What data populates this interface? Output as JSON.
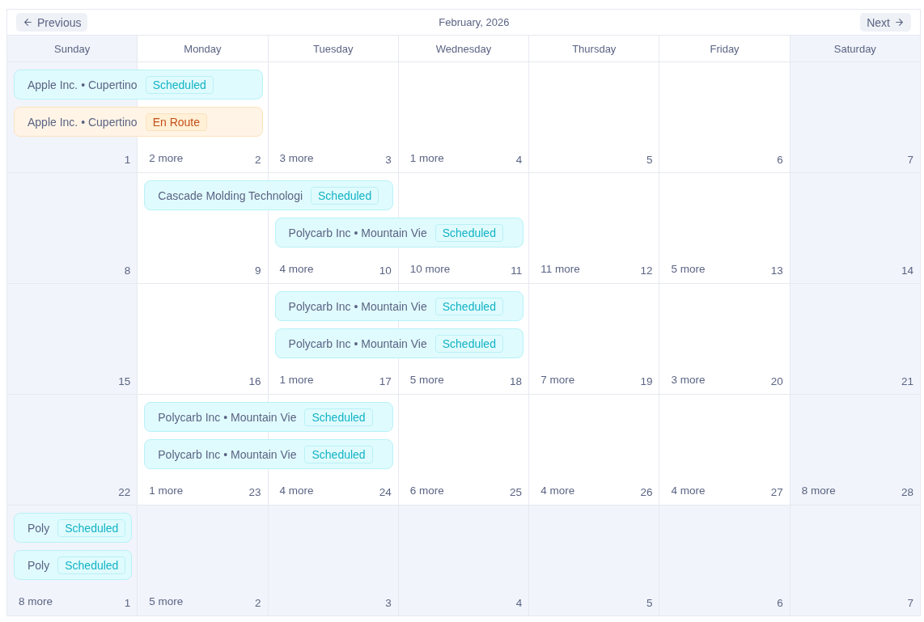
{
  "header": {
    "previous": "Previous",
    "title": "February, 2026",
    "next": "Next"
  },
  "weekdays": [
    {
      "label": "Sunday",
      "muted": true
    },
    {
      "label": "Monday",
      "muted": false
    },
    {
      "label": "Tuesday",
      "muted": false
    },
    {
      "label": "Wednesday",
      "muted": false
    },
    {
      "label": "Thursday",
      "muted": false
    },
    {
      "label": "Friday",
      "muted": false
    },
    {
      "label": "Saturday",
      "muted": true
    }
  ],
  "weeks": [
    {
      "days": [
        {
          "date": "1",
          "muted": true,
          "events": [
            {
              "title": "Apple Inc. • Cupertino",
              "status": "Scheduled",
              "kind": "scheduled",
              "multi_day": true
            },
            {
              "title": "Apple Inc. • Cupertino",
              "status": "En Route",
              "kind": "en_route",
              "multi_day": true
            }
          ]
        },
        {
          "date": "2",
          "more": "2 more",
          "muted": false
        },
        {
          "date": "3",
          "more": "3 more",
          "muted": false
        },
        {
          "date": "4",
          "more": "1 more",
          "muted": false
        },
        {
          "date": "5",
          "muted": false
        },
        {
          "date": "6",
          "muted": false
        },
        {
          "date": "7",
          "muted": true
        }
      ]
    },
    {
      "days": [
        {
          "date": "8",
          "muted": true
        },
        {
          "date": "9",
          "muted": false,
          "events": [
            {
              "title": "Cascade Molding Technologi",
              "status": "Scheduled",
              "kind": "scheduled",
              "multi_day": true
            }
          ]
        },
        {
          "date": "10",
          "more": "4 more",
          "muted": false,
          "events": [
            {
              "title": "Polycarb Inc • Mountain Vie",
              "status": "Scheduled",
              "kind": "scheduled",
              "multi_day": true
            }
          ]
        },
        {
          "date": "11",
          "more": "10 more",
          "muted": false
        },
        {
          "date": "12",
          "more": "11 more",
          "muted": false
        },
        {
          "date": "13",
          "more": "5 more",
          "muted": false
        },
        {
          "date": "14",
          "muted": true
        }
      ]
    },
    {
      "days": [
        {
          "date": "15",
          "muted": true
        },
        {
          "date": "16",
          "muted": false
        },
        {
          "date": "17",
          "more": "1 more",
          "muted": false,
          "events": [
            {
              "title": "Polycarb Inc • Mountain Vie",
              "status": "Scheduled",
              "kind": "scheduled",
              "multi_day": true
            },
            {
              "title": "Polycarb Inc • Mountain Vie",
              "status": "Scheduled",
              "kind": "scheduled",
              "multi_day": true
            }
          ]
        },
        {
          "date": "18",
          "more": "5 more",
          "muted": false
        },
        {
          "date": "19",
          "more": "7 more",
          "muted": false
        },
        {
          "date": "20",
          "more": "3 more",
          "muted": false
        },
        {
          "date": "21",
          "muted": true
        }
      ]
    },
    {
      "days": [
        {
          "date": "22",
          "muted": true
        },
        {
          "date": "23",
          "more": "1 more",
          "muted": false,
          "events": [
            {
              "title": "Polycarb Inc • Mountain Vie",
              "status": "Scheduled",
              "kind": "scheduled",
              "multi_day": true
            },
            {
              "title": "Polycarb Inc • Mountain Vie",
              "status": "Scheduled",
              "kind": "scheduled",
              "multi_day": true
            }
          ]
        },
        {
          "date": "24",
          "more": "4 more",
          "muted": false
        },
        {
          "date": "25",
          "more": "6 more",
          "muted": false
        },
        {
          "date": "26",
          "more": "4 more",
          "muted": false
        },
        {
          "date": "27",
          "more": "4 more",
          "muted": false
        },
        {
          "date": "28",
          "more": "8 more",
          "muted": true
        }
      ]
    },
    {
      "days": [
        {
          "date": "1",
          "more": "8 more",
          "muted": true,
          "events": [
            {
              "title": "Poly",
              "status": "Scheduled",
              "kind": "scheduled",
              "multi_day": false
            },
            {
              "title": "Poly",
              "status": "Scheduled",
              "kind": "scheduled",
              "multi_day": false
            }
          ]
        },
        {
          "date": "2",
          "more": "5 more",
          "muted": true
        },
        {
          "date": "3",
          "muted": true
        },
        {
          "date": "4",
          "muted": true
        },
        {
          "date": "5",
          "muted": true
        },
        {
          "date": "6",
          "muted": true
        },
        {
          "date": "7",
          "muted": true
        }
      ]
    }
  ]
}
